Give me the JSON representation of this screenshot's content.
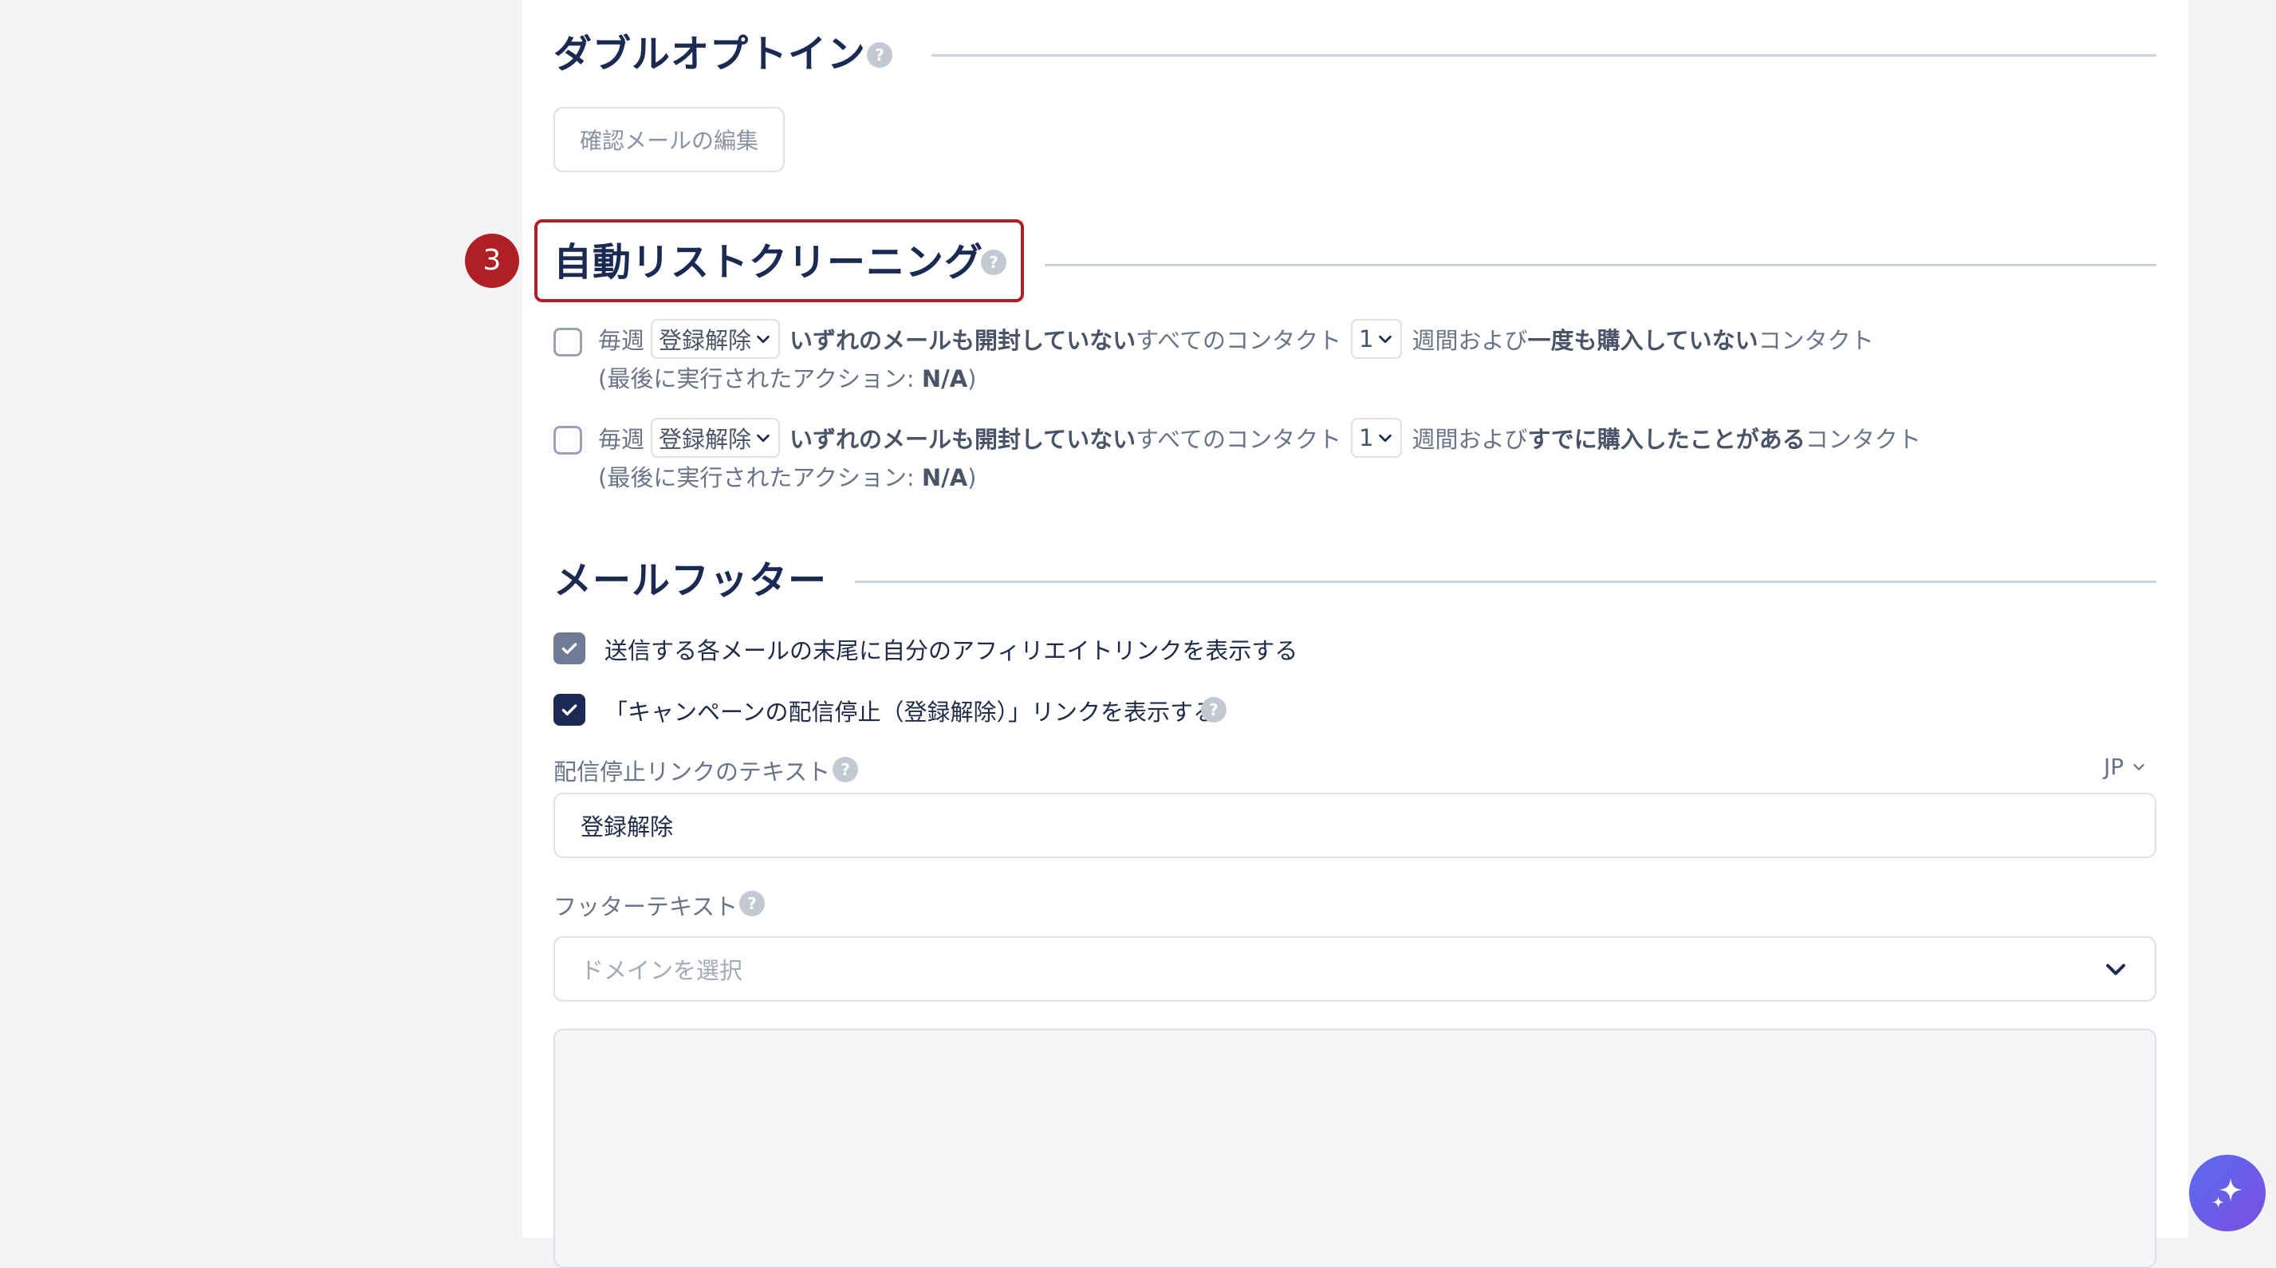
{
  "double_optin": {
    "title": "ダブルオプトイン",
    "help_glyph": "?",
    "edit_button_label": "確認メールの編集"
  },
  "auto_clean": {
    "step_number": "3",
    "title": "自動リストクリーニング",
    "help_glyph": "?",
    "highlight_color": "#b01f24",
    "rules": [
      {
        "checked": false,
        "prefix": "毎週",
        "action_select": "登録解除",
        "cond_bold": "いずれのメールも開封していない",
        "cond_text": "すべてのコンタクト",
        "weeks_select": "1",
        "weeks_text": "週間および",
        "purchase_bold": "一度も購入していない",
        "suffix": "コンタクト",
        "last_run_prefix": "(最後に実行されたアクション: ",
        "last_run_value": "N/A",
        "last_run_suffix": ")"
      },
      {
        "checked": false,
        "prefix": "毎週",
        "action_select": "登録解除",
        "cond_bold": "いずれのメールも開封していない",
        "cond_text": "すべてのコンタクト",
        "weeks_select": "1",
        "weeks_text": "週間および",
        "purchase_bold": "すでに購入したことがある",
        "suffix": "コンタクト",
        "last_run_prefix": "(最後に実行されたアクション: ",
        "last_run_value": "N/A",
        "last_run_suffix": ")"
      }
    ]
  },
  "footer": {
    "title": "メールフッター",
    "affiliate_label": "送信する各メールの末尾に自分のアフィリエイトリンクを表示する",
    "affiliate_checked": true,
    "unsubscribe_label": "「キャンペーンの配信停止（登録解除）」リンクを表示する",
    "unsubscribe_checked": true,
    "unsubscribe_text_label": "配信停止リンクのテキスト",
    "language": "JP",
    "unsubscribe_text_value": "登録解除",
    "footer_text_label": "フッターテキスト",
    "domain_placeholder": "ドメインを選択",
    "help_glyph": "?"
  },
  "colors": {
    "heading": "#1b2a52",
    "checkbox_filled": "#1b2a52",
    "checkbox_muted": "#6f7a95",
    "accent_fab": "#5b6cf0"
  },
  "icons": {
    "fab": "sparkle-icon",
    "dropdown": "chevron-down-icon",
    "check": "check-icon"
  }
}
